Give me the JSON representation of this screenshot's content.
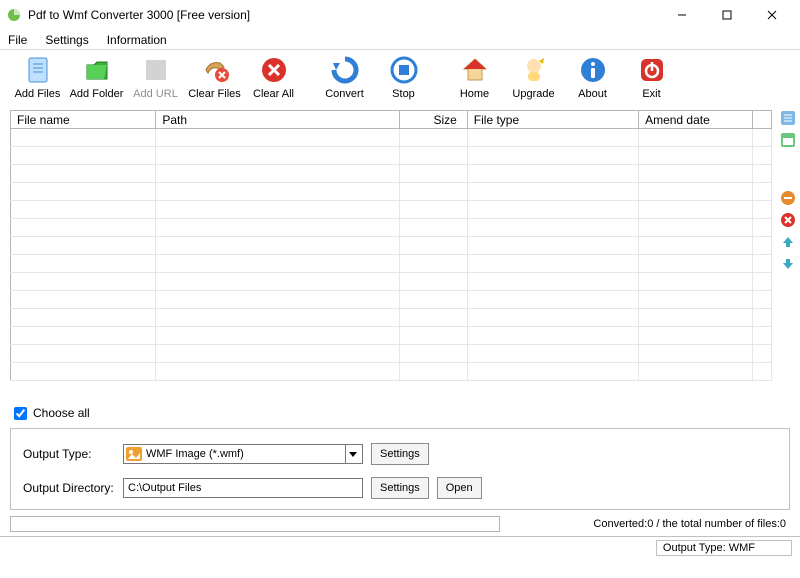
{
  "title": "Pdf to Wmf Converter 3000 [Free version]",
  "menu": {
    "file": "File",
    "settings": "Settings",
    "info": "Information"
  },
  "toolbar": {
    "addFiles": "Add Files",
    "addFolder": "Add Folder",
    "addURL": "Add URL",
    "clearFiles": "Clear Files",
    "clearAll": "Clear All",
    "convert": "Convert",
    "stop": "Stop",
    "home": "Home",
    "upgrade": "Upgrade",
    "about": "About",
    "exit": "Exit"
  },
  "columns": {
    "filename": "File name",
    "path": "Path",
    "size": "Size",
    "filetype": "File type",
    "amend": "Amend date"
  },
  "chooseAll": "Choose all",
  "output": {
    "typeLabel": "Output Type:",
    "typeValue": "WMF Image (*.wmf)",
    "dirLabel": "Output Directory:",
    "dirValue": "C:\\Output Files",
    "settings": "Settings",
    "open": "Open"
  },
  "status": {
    "converted": "Converted:0  /  the total number of files:0",
    "outType": "Output Type: WMF"
  },
  "colors": {
    "blue": "#2f7fd6",
    "green": "#2fa32f",
    "red": "#d9322a",
    "orange": "#e68a2e",
    "yellow": "#f2c14e",
    "teal": "#3aa7c4"
  }
}
